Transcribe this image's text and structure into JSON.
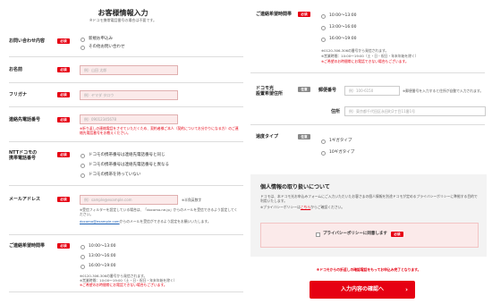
{
  "page": {
    "title": "お客様情報入力",
    "subtitle": "※ドコモ携帯電話番号の場合は不要です。"
  },
  "badges": {
    "required": "必須",
    "optional": "任意"
  },
  "inquiry": {
    "label": "お問い合わせ内容",
    "options": [
      "新規お申込み",
      "その他お問い合わせ"
    ]
  },
  "name": {
    "label": "お名前",
    "placeholder": "例）山田 太郎"
  },
  "furigana": {
    "label": "フリガナ",
    "placeholder": "例）ヤマダ タロウ"
  },
  "phone": {
    "label": "連絡先電話番号",
    "placeholder": "例）09012345678",
    "note": "※折り返しの連絡電話をさせていただくため、契約者様ご本人（契約についてお分かりになる方）のご連絡先電話番号をお教えください。"
  },
  "docomo_number": {
    "label_line1": "NTTドコモの",
    "label_line2": "携帯電話番号",
    "options": [
      "ドコモの携帯番号は連絡先電話番号と同じ",
      "ドコモの携帯番号は連絡先電話番号と異なる",
      "ドコモの携帯を持っていない"
    ]
  },
  "email": {
    "label": "メールアドレス",
    "placeholder": "例）sample@example.com",
    "side_note": "※半角英数字",
    "note1": "※受信フィルターを設定している場合は、「docomo.ne.jp」からのメールを受信できるよう設定してください。",
    "note2_link": "docomo@example.com",
    "note2_rest": "からのメールを受信ができるよう設定をお願いいたします。"
  },
  "contact_time_left": {
    "label": "ご連絡希望時間帯",
    "options": [
      "10:00〜13:00",
      "13:00〜16:00",
      "16:00〜19:00"
    ],
    "note1": "※0120-306-306の番号から発信されます。",
    "note2": "※営業時間：10:00〜19:00（土・日・祝日・年末年始を除く）",
    "note3": "※ご希望のお時間帯にお電話できない場合もございます。"
  },
  "contact_time_right": {
    "label": "ご連絡希望時間帯",
    "options": [
      "10:00〜13:00",
      "13:00〜16:00",
      "16:00〜19:00"
    ],
    "note1": "※0120-306-306の番号から発信されます。",
    "note2": "※営業時間：10:00〜19:00（土・日・祝日・年末年始を除く）",
    "note3": "※ご希望のお時間帯にお電話できない場合もございます。"
  },
  "address": {
    "label_line1": "ドコモ光",
    "label_line2": "設置希望住所",
    "zip_label": "郵便番号",
    "zip_placeholder": "例）100-6150",
    "zip_note": "※郵便番号を入力すると住所が自動で入力されます。",
    "addr_label": "住所",
    "addr_placeholder": "例）東京都千代田区永田町2丁目11番1号"
  },
  "plan": {
    "label": "速度タイプ",
    "options": [
      "1ギガタイプ",
      "10ギガタイプ"
    ]
  },
  "privacy": {
    "heading": "個人情報の取り扱いについて",
    "body": "ドコモは、本ドコモ光お申込みフォームにご入力いただいたお客さまの個人情報を別途ドコモが定めるプライバシーポリシーに準拠する目的で利用いたします。",
    "link_prefix": "※プライバシーポリシーは",
    "link_text": "こちら",
    "link_suffix": "からご確認ください。",
    "agree_label": "プライバシーポリシーに同意します"
  },
  "submit": {
    "note": "※ドコモからの折返しの確認電話をもってお申込み完了となります。",
    "button_label": "入力内容の確認へ"
  },
  "colors": {
    "accent": "#e60012",
    "field_bg": "#fbeaea"
  }
}
